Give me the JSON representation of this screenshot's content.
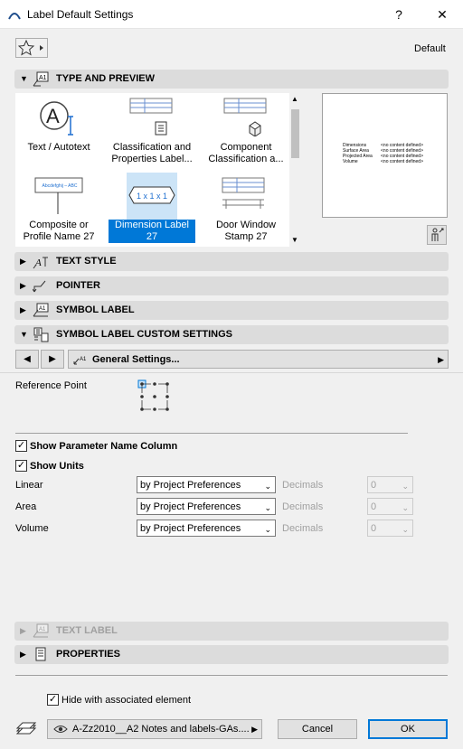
{
  "window": {
    "title": "Label Default Settings",
    "help_glyph": "?",
    "close_glyph": "✕"
  },
  "favorites": {
    "label": "Default"
  },
  "sections": {
    "type_preview": "TYPE AND PREVIEW",
    "text_style": "TEXT STYLE",
    "pointer": "POINTER",
    "symbol_label": "SYMBOL LABEL",
    "custom_settings": "SYMBOL LABEL CUSTOM SETTINGS",
    "text_label": "TEXT LABEL",
    "properties": "PROPERTIES"
  },
  "tiles": [
    {
      "label": "Text / Autotext",
      "icon": "text-autotext-icon"
    },
    {
      "label": "Classification and Properties Label...",
      "icon": "classification-label-icon"
    },
    {
      "label": "Component Classification a...",
      "icon": "component-classification-icon"
    },
    {
      "label": "Composite or Profile Name 27",
      "icon": "composite-profile-icon",
      "preview_text": "Abcdefghij – ABC"
    },
    {
      "label": "Dimension Label 27",
      "icon": "dimension-label-icon",
      "preview_text": "1 x 1 x 1",
      "selected": true
    },
    {
      "label": "Door Window Stamp 27",
      "icon": "door-window-stamp-icon"
    }
  ],
  "preview": {
    "rows": [
      {
        "name": "Dimensions",
        "value": "<no content defined>"
      },
      {
        "name": "Surface Area",
        "value": "<no content defined>"
      },
      {
        "name": "Projected Area",
        "value": "<no content defined>"
      },
      {
        "name": "Volume",
        "value": "<no content defined>"
      }
    ]
  },
  "custom": {
    "page_label": "General Settings...",
    "reference_point_label": "Reference Point",
    "show_param_label": "Show Parameter Name Column",
    "show_param_checked": true,
    "show_units_label": "Show Units",
    "show_units_checked": true,
    "rows": [
      {
        "label": "Linear",
        "value": "by Project Preferences",
        "decimals_label": "Decimals",
        "decimals_value": "0"
      },
      {
        "label": "Area",
        "value": "by Project Preferences",
        "decimals_label": "Decimals",
        "decimals_value": "0"
      },
      {
        "label": "Volume",
        "value": "by Project Preferences",
        "decimals_label": "Decimals",
        "decimals_value": "0"
      }
    ]
  },
  "footer": {
    "hide_label": "Hide with associated element",
    "hide_checked": true,
    "layer_value": "A-Zz2010__A2 Notes and labels-GAs....",
    "cancel": "Cancel",
    "ok": "OK"
  },
  "colors": {
    "accent": "#0078d7",
    "section_bg": "#dcdcdc"
  }
}
